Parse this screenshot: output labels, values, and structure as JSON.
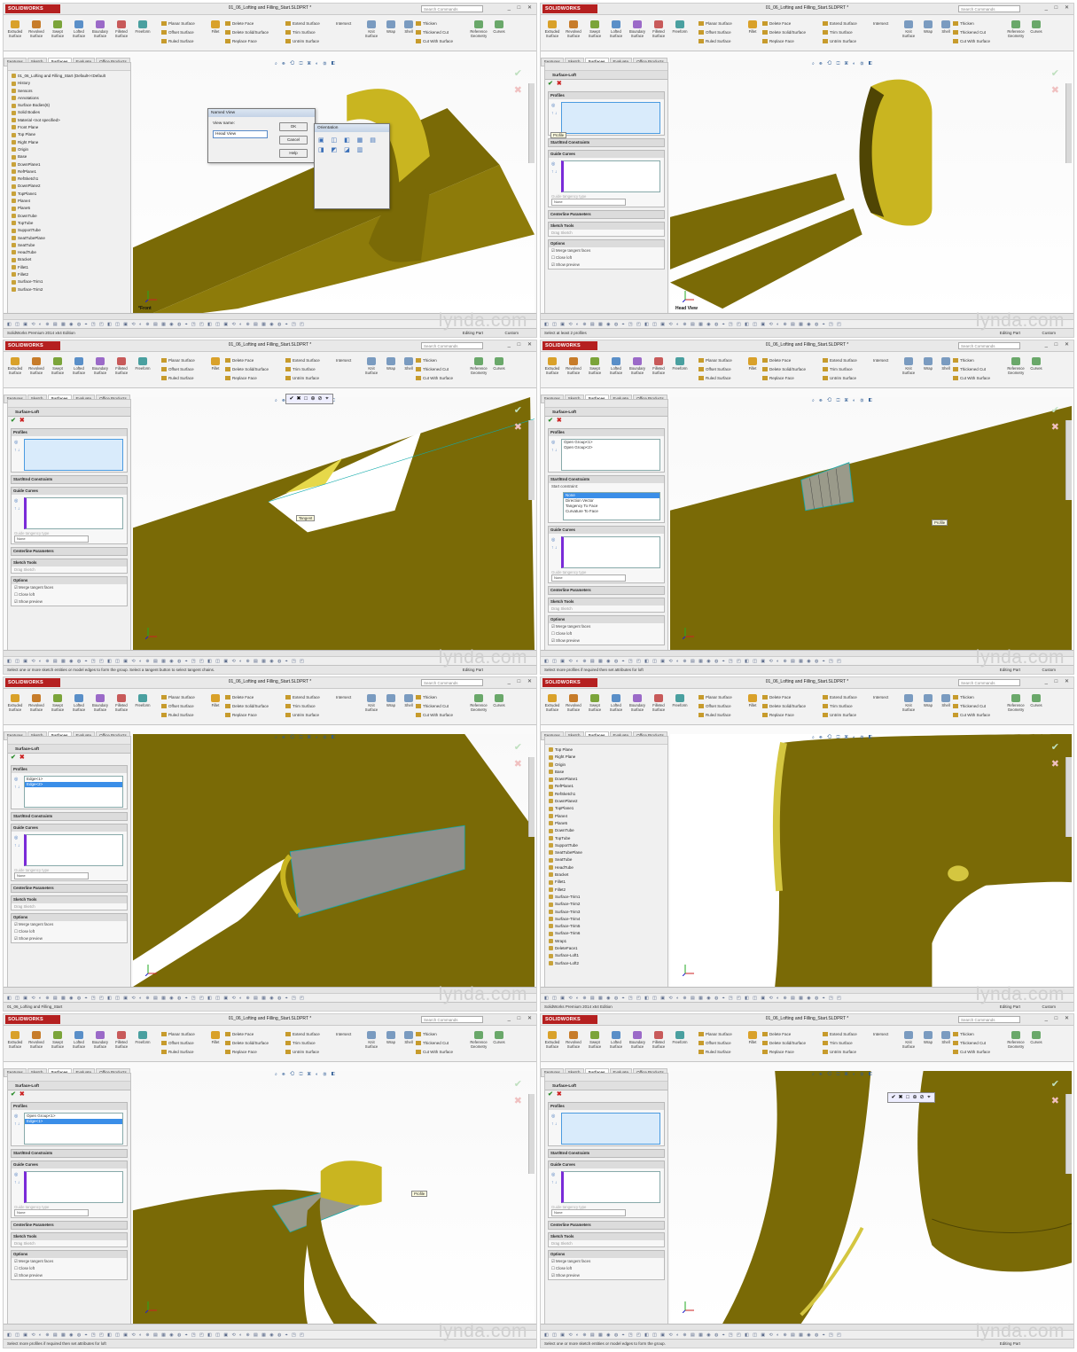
{
  "app": {
    "logo": "SOLIDWORKS",
    "doc_title": "01_06_Lofting and Filling_Start.SLDPRT *",
    "search_placeholder": "Search Commands",
    "window_buttons": "_ □ ✕"
  },
  "ribbon": {
    "big_buttons": [
      "Extruded Surface",
      "Revolved Surface",
      "Swept Surface",
      "Lofted Surface",
      "Boundary Surface",
      "Filleted Surface",
      "Freeform"
    ],
    "col1": [
      "Planar Surface",
      "Offset Surface",
      "Ruled Surface"
    ],
    "mid_buttons": [
      "Fillet"
    ],
    "col2": [
      "Delete Face",
      "Delete Solid/Surface",
      "Replace Face"
    ],
    "col3": [
      "Extend Surface",
      "Trim Surface",
      "Untrim Surface"
    ],
    "col3b": "Intersect",
    "knit": "Knit Surface",
    "wrap": "Wrap",
    "shell": "Shell",
    "col4": [
      "Thicken",
      "Thickened Cut",
      "Cut With Surface"
    ],
    "refgeo": "Reference Geometry",
    "curves": "Curves"
  },
  "cmd_tabs": [
    "Features",
    "Sketch",
    "Surfaces",
    "Evaluate",
    "Office Products"
  ],
  "bottom_tabs": [
    "Model",
    "Motion Study 1"
  ],
  "heads_up_glyphs": "◧ ◫ ▣ ⟲ ◐ ⊕ ▤ ▦ ◉ ◍ ⌖ ◳ ◰",
  "vp_toolbar": "⌕ ⊕ ⟲ ◫ ▣ ◐ ⚙ ◧",
  "watermark": "lynda.com",
  "feature_tree": [
    "01_06_Lofting and Filling_Start  (Default<<Default",
    "History",
    "Sensors",
    "Annotations",
    "Surface Bodies(6)",
    "Solid Bodies",
    "Material <not specified>",
    "Front Plane",
    "Top Plane",
    "Right Plane",
    "Origin",
    "Base",
    "DownPlane1",
    "RefPlane1",
    "RefSketch1",
    "DownPlane2",
    "TopPlane1",
    "Plane4",
    "Plane5",
    "DownTube",
    "TopTube",
    "SupportTube",
    "SeatTubePlane",
    "SeatTube",
    "HeadTube",
    "Bracket",
    "Fillet1",
    "Fillet2",
    "Surface-Trim1",
    "Surface-Trim2"
  ],
  "feature_tree_2": [
    "Top Plane",
    "Right Plane",
    "Origin",
    "Base",
    "DownPlane1",
    "RefPlane1",
    "RefSketch1",
    "DownPlane2",
    "TopPlane1",
    "Plane4",
    "Plane5",
    "DownTube",
    "TopTube",
    "SupportTube",
    "SeatTubePlane",
    "SeatTube",
    "HeadTube",
    "Bracket",
    "Fillet1",
    "Fillet2",
    "Surface-Trim1",
    "Surface-Trim2",
    "Surface-Trim3",
    "Surface-Trim4",
    "Surface-Trim5",
    "Surface-Trim6",
    "Wrap1",
    "DeleteFace1",
    "Surface-Loft1",
    "Surface-Loft2"
  ],
  "loft": {
    "title": "Surface-Loft",
    "sections": [
      "Profiles",
      "Start/End Constraints",
      "Guide Curves",
      "Centerline Parameters",
      "Sketch Tools",
      "Options"
    ],
    "none": "None",
    "tangent_hint": "Guide tangency type",
    "drag_sketch": "Drag Sketch",
    "options": [
      "Merge tangent faces",
      "Close loft",
      "Show preview"
    ],
    "start_constraint": "Start constraint:",
    "constraint_options": [
      "None",
      "Direction Vector",
      "Tangency To Face",
      "Curvature To Face"
    ],
    "profile_tooltip": "Profile"
  },
  "named_view": {
    "title": "Named View",
    "label": "View name:",
    "value": "Head View",
    "ok": "OK",
    "cancel": "Cancel",
    "help": "Help",
    "orientation_title": "Orientation"
  },
  "frames": [
    {
      "id": "f1",
      "view_label": "*Front",
      "status": "SolidWorks Premium 2014 x64 Edition",
      "status_mid": "Editing Part",
      "status_right": "Custom",
      "mode": "tree"
    },
    {
      "id": "f2",
      "view_label": "Head View",
      "status": "Select at least 2 profiles",
      "status_mid": "Editing Part",
      "status_right": "Custom",
      "mode": "loft",
      "profiles": [],
      "tooltip": "Profile"
    },
    {
      "id": "f3",
      "view_label": "",
      "status": "Select one or more sketch entities or model edges to form the group.  Select a tangent button to select tangent chains.",
      "status_mid": "Editing Part",
      "status_right": "",
      "mode": "loft",
      "profiles": [],
      "tooltip": "Tangent"
    },
    {
      "id": "f4",
      "view_label": "",
      "status": "Select more profiles if required then set attributes for loft",
      "status_mid": "Editing Part",
      "status_right": "Custom",
      "mode": "loft-dropdown",
      "profiles": [
        "Open Group<1>",
        "Open Group<2>"
      ],
      "tooltip": "Profile"
    },
    {
      "id": "f5",
      "view_label": "",
      "status": "01_06_Lofting and Filling_Start",
      "status_mid": "",
      "status_right": "",
      "mode": "loft",
      "profiles": [
        "Edge<1>",
        "Edge<2>"
      ],
      "selected": 1
    },
    {
      "id": "f6",
      "view_label": "",
      "status": "SolidWorks Premium 2014 x64 Edition",
      "status_mid": "Editing Part",
      "status_right": "Custom",
      "mode": "tree2"
    },
    {
      "id": "f7",
      "view_label": "",
      "status": "Select more profiles if required then set attributes for loft",
      "status_mid": "",
      "status_right": "",
      "mode": "loft",
      "profiles": [
        "Open Group<1>",
        "Edge<1>"
      ],
      "selected": 1,
      "tooltip": "Profile"
    },
    {
      "id": "f8",
      "view_label": "",
      "status": "Select one or more sketch entities or model edges to form the group.",
      "status_mid": "Editing Part",
      "status_right": "",
      "mode": "loft",
      "profiles": []
    }
  ],
  "colors": {
    "olive": "#7a6a06",
    "olive_light": "#c9b520",
    "olive_dark": "#4f4504",
    "selection_blue": "#3a8ee8",
    "brand_red": "#b52020"
  }
}
